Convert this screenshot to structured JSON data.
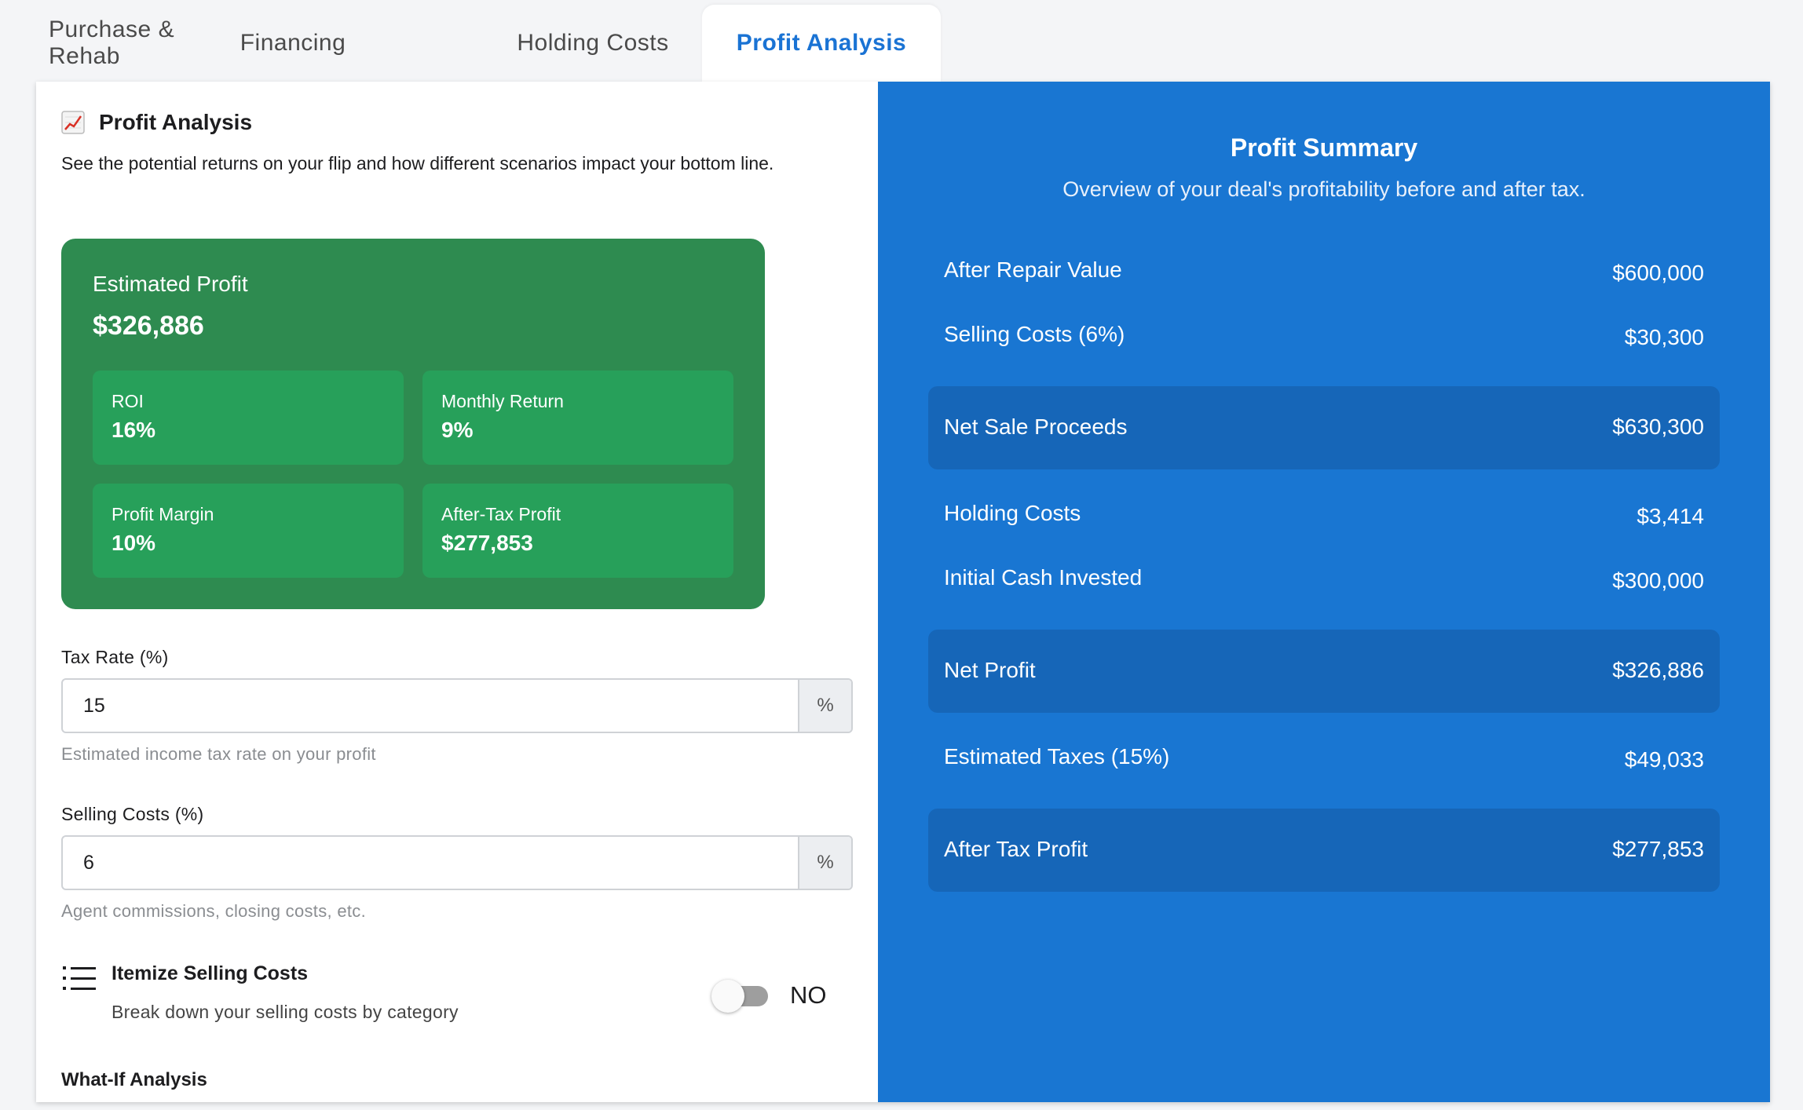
{
  "tabs": [
    {
      "label": "Purchase & Rehab"
    },
    {
      "label": "Financing"
    },
    {
      "label": "Holding Costs"
    },
    {
      "label": "Profit Analysis",
      "active": true
    }
  ],
  "section": {
    "title": "Profit Analysis",
    "icon": "chart-increasing-icon",
    "description": "See the potential returns on your flip and how different scenarios impact your bottom line."
  },
  "estimated_profit": {
    "label": "Estimated Profit",
    "value": "$326,886",
    "metrics": [
      {
        "label": "ROI",
        "value": "16%"
      },
      {
        "label": "Monthly Return",
        "value": "9%"
      },
      {
        "label": "Profit Margin",
        "value": "10%"
      },
      {
        "label": "After-Tax Profit",
        "value": "$277,853"
      }
    ]
  },
  "tax_rate": {
    "label": "Tax Rate (%)",
    "value": "15",
    "suffix": "%",
    "hint": "Estimated income tax rate on your profit"
  },
  "selling_costs": {
    "label": "Selling Costs (%)",
    "value": "6",
    "suffix": "%",
    "hint": "Agent commissions, closing costs, etc."
  },
  "itemize": {
    "icon": "list-icon",
    "title": "Itemize Selling Costs",
    "description": "Break down your selling costs by category",
    "toggle_state": "NO"
  },
  "what_if": {
    "title": "What-If Analysis"
  },
  "summary": {
    "title": "Profit Summary",
    "subtitle": "Overview of your deal's profitability before and after tax.",
    "rows": [
      {
        "label": "After Repair Value",
        "value": "$600,000"
      },
      {
        "label": "Selling Costs (6%)",
        "value": "$30,300"
      },
      {
        "label": "Net Sale Proceeds",
        "value": "$630,300",
        "highlight": true
      },
      {
        "label": "Holding Costs",
        "value": "$3,414"
      },
      {
        "label": "Initial Cash Invested",
        "value": "$300,000"
      },
      {
        "label": "Net Profit",
        "value": "$326,886",
        "highlight": true
      },
      {
        "label": "Estimated Taxes (15%)",
        "value": "$49,033"
      },
      {
        "label": "After Tax Profit",
        "value": "$277,853",
        "highlight": true
      }
    ]
  },
  "colors": {
    "accent": "#1a73d4",
    "summary_bg": "#1976d2",
    "summary_highlight": "#1666b8",
    "profit_bg": "#2e8b50",
    "metric_bg": "#27a05a"
  }
}
